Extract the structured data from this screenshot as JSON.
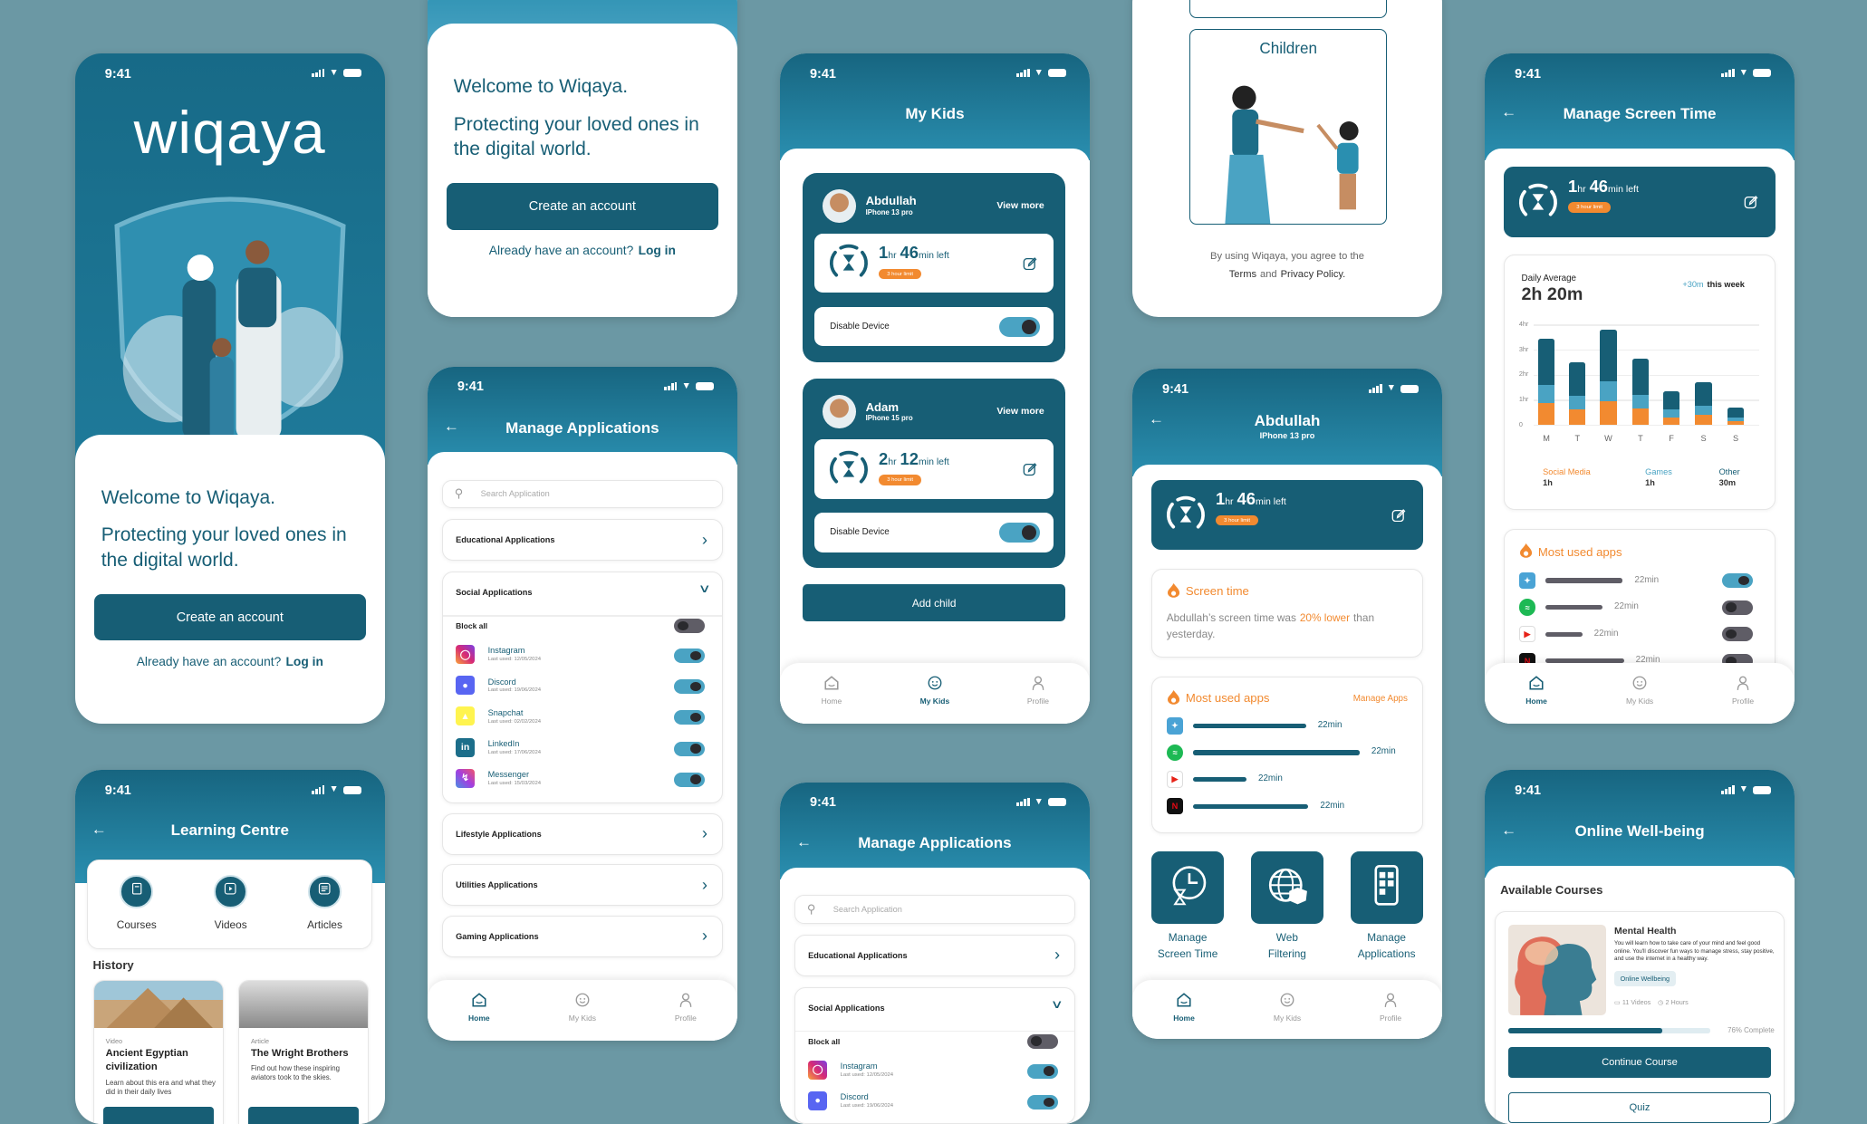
{
  "status_time": "9:41",
  "colors": {
    "primary": "#175e75",
    "accent": "#f28a30",
    "light_blue": "#4aa3c3",
    "background": "#6b98a4"
  },
  "units": {
    "hr": "hr",
    "min_left": "min left"
  },
  "nav": {
    "home": "Home",
    "kids": "My Kids",
    "profile": "Profile"
  },
  "splash": {
    "logo": "wiqaya",
    "welcome": "Welcome to Wiqaya.",
    "tagline": "Protecting your loved ones in the digital world.",
    "create_account": "Create an account",
    "have_account": "Already have an account?",
    "login": "Log in"
  },
  "welcome": {
    "welcome": "Welcome to Wiqaya.",
    "tagline": "Protecting your loved ones in the digital world.",
    "create_account": "Create an account",
    "have_account": "Already have an account?",
    "login": "Log in"
  },
  "manage_apps": {
    "title": "Manage Applications",
    "search_placeholder": "Search Application",
    "educational": "Educational Applications",
    "social": "Social Applications",
    "block_all": "Block all",
    "block_all_on": false,
    "apps": [
      {
        "name": "Instagram",
        "last_used": "Last used: 12/05/2024",
        "icon": "instagram-icon",
        "enabled": true
      },
      {
        "name": "Discord",
        "last_used": "Last used: 19/06/2024",
        "icon": "discord-icon",
        "enabled": true
      },
      {
        "name": "Snapchat",
        "last_used": "Last used: 02/02/2024",
        "icon": "snapchat-icon",
        "enabled": true
      },
      {
        "name": "LinkedIn",
        "last_used": "Last used: 17/06/2024",
        "icon": "linkedin-icon",
        "enabled": true
      },
      {
        "name": "Messenger",
        "last_used": "Last used: 15/03/2024",
        "icon": "messenger-icon",
        "enabled": true
      }
    ],
    "other_categories": [
      "Lifestyle Applications",
      "Utilities Applications",
      "Gaming Applications"
    ]
  },
  "manage_apps_2": {
    "title": "Manage Applications",
    "search_placeholder": "Search Application",
    "educational": "Educational Applications",
    "social": "Social Applications",
    "block_all": "Block all",
    "block_all_on": false,
    "apps": [
      {
        "name": "Instagram",
        "last_used": "Last used: 12/05/2024",
        "icon": "instagram-icon",
        "enabled": true
      },
      {
        "name": "Discord",
        "last_used": "Last used: 19/06/2024",
        "icon": "discord-icon",
        "enabled": true
      }
    ],
    "other_categories": []
  },
  "my_kids": {
    "title": "My Kids",
    "view_more": "View more",
    "disable_device": "Disable Device",
    "add_child": "Add child",
    "kids": [
      {
        "name": "Abdullah",
        "device": "IPhone 13 pro",
        "hours": "1",
        "minutes": "46",
        "limit": "3 hour limit",
        "disabled": true
      },
      {
        "name": "Adam",
        "device": "IPhone 15 pro",
        "hours": "2",
        "minutes": "12",
        "limit": "3 hour limit",
        "disabled": true
      }
    ]
  },
  "terms": {
    "children": "Children",
    "line1": "By using Wiqaya, you agree to the",
    "terms": "Terms",
    "and": "and",
    "privacy": "Privacy Policy."
  },
  "child_detail": {
    "name": "Abdullah",
    "device": "IPhone 13 pro",
    "hours": "1",
    "minutes": "46",
    "limit": "3 hour limit",
    "screen_time_title": "Screen time",
    "screen_time_pre": "Abdullah’s screen time was",
    "screen_time_highlight": "20% lower",
    "screen_time_post": "than yesterday.",
    "most_used_title": "Most used apps",
    "manage_apps_link": "Manage Apps",
    "apps": [
      {
        "icon": "twitter-icon",
        "usage": "22min",
        "bar": 0.68
      },
      {
        "icon": "spotify-icon",
        "usage": "22min",
        "bar": 1.0
      },
      {
        "icon": "youtube-icon",
        "usage": "22min",
        "bar": 0.32
      },
      {
        "icon": "netflix-icon",
        "usage": "22min",
        "bar": 0.69
      }
    ],
    "tiles": [
      {
        "label1": "Manage",
        "label2": "Screen Time",
        "icon": "screen-time-icon"
      },
      {
        "label1": "Web",
        "label2": "Filtering",
        "icon": "web-filter-icon"
      },
      {
        "label1": "Manage",
        "label2": "Applications",
        "icon": "manage-apps-icon"
      }
    ]
  },
  "screen_time": {
    "title": "Manage Screen Time",
    "hours": "1",
    "minutes": "46",
    "limit": "3 hour limit",
    "daily_average_label": "Daily Average",
    "daily_average": "2h 20m",
    "weekly_change": "+30m",
    "weekly_change_suffix": "this week",
    "chart": {
      "type": "bar",
      "stacked": true,
      "categories": [
        "M",
        "T",
        "W",
        "T",
        "F",
        "S",
        "S"
      ],
      "y_ticks": [
        "0",
        "1hr",
        "2hr",
        "3hr",
        "4hr"
      ],
      "ylim": [
        0,
        4
      ],
      "series": [
        {
          "name": "Social Media",
          "color": "#f28a30",
          "values": [
            0.85,
            0.6,
            0.95,
            0.65,
            0.3,
            0.4,
            0.15
          ]
        },
        {
          "name": "Games",
          "color": "#4aa3c3",
          "values": [
            0.75,
            0.55,
            0.8,
            0.55,
            0.3,
            0.35,
            0.15
          ]
        },
        {
          "name": "Other",
          "color": "#175e75",
          "values": [
            1.85,
            1.35,
            2.05,
            1.45,
            0.75,
            0.95,
            0.4
          ]
        }
      ]
    },
    "legend": [
      {
        "name": "Social Media",
        "value": "1h",
        "color": "#f28a30"
      },
      {
        "name": "Games",
        "value": "1h",
        "color": "#4aa3c3"
      },
      {
        "name": "Other",
        "value": "30m",
        "color": "#175e75"
      }
    ],
    "most_used_title": "Most used apps",
    "apps": [
      {
        "icon": "twitter-icon",
        "usage": "22min",
        "bar": 0.68,
        "enabled": true
      },
      {
        "icon": "spotify-icon",
        "usage": "22min",
        "bar": 0.5,
        "enabled": false
      },
      {
        "icon": "youtube-icon",
        "usage": "22min",
        "bar": 0.32,
        "enabled": false
      },
      {
        "icon": "netflix-icon",
        "usage": "22min",
        "bar": 0.69,
        "enabled": false
      }
    ]
  },
  "wellbeing": {
    "title": "Online Well-being",
    "section": "Available Courses",
    "course": {
      "title": "Mental Health",
      "description": "You will learn how to take care of your mind and feel good online. You'll discover fun ways to manage stress, stay positive, and use the internet in a healthy way.",
      "tag": "Online Wellbeing",
      "videos": "11 Videos",
      "duration": "2 Hours",
      "progress": 76,
      "progress_label": "76% Complete",
      "continue": "Continue Course",
      "quiz": "Quiz"
    }
  },
  "learning": {
    "title": "Learning Centre",
    "categories": [
      {
        "label": "Courses",
        "icon": "courses-icon"
      },
      {
        "label": "Videos",
        "icon": "videos-icon"
      },
      {
        "label": "Articles",
        "icon": "articles-icon"
      }
    ],
    "section": "History",
    "items": [
      {
        "type": "Video",
        "title": "Ancient Egyptian civilization",
        "description": "Learn about this era and what they did in their daily lives"
      },
      {
        "type": "Article",
        "title": "The Wright Brothers",
        "description": "Find out how these inspiring aviators took to the skies."
      }
    ]
  }
}
